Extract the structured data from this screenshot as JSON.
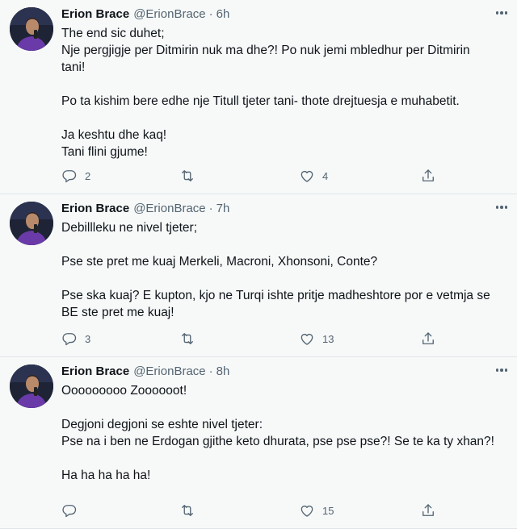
{
  "tweets": [
    {
      "author": {
        "name": "Erion Brace",
        "handle": "@ErionBrace"
      },
      "separator": "·",
      "time": "6h",
      "lines": [
        "The end sic duhet;",
        "Nje pergjigje per Ditmirin nuk ma dhe?! Po nuk jemi mbledhur per Ditmirin",
        "tani!",
        "",
        "Po ta kishim bere edhe nje Titull tjeter tani- thote drejtuesja e muhabetit.",
        "",
        "Ja keshtu dhe kaq!",
        "Tani flini gjume!"
      ],
      "stats": {
        "replies": "2",
        "retweets": "",
        "likes": "4"
      }
    },
    {
      "author": {
        "name": "Erion Brace",
        "handle": "@ErionBrace"
      },
      "separator": "·",
      "time": "7h",
      "lines": [
        "Debillleku ne nivel tjeter;",
        "",
        "Pse ste pret me kuaj Merkeli, Macroni, Xhonsoni, Conte?",
        "",
        "Pse ska kuaj? E kupton, kjo ne Turqi ishte pritje madheshtore por e vetmja se",
        "BE ste pret me kuaj!"
      ],
      "stats": {
        "replies": "3",
        "retweets": "",
        "likes": "13"
      }
    },
    {
      "author": {
        "name": "Erion Brace",
        "handle": "@ErionBrace"
      },
      "separator": "·",
      "time": "8h",
      "lines": [
        "Ooooooooo Zoooooot!",
        "",
        "Degjoni degjoni se eshte nivel tjeter:",
        "Pse na i ben ne Erdogan gjithe keto dhurata, pse pse pse?! Se te ka ty xhan?!",
        "",
        "Ha ha ha ha ha!"
      ],
      "stats": {
        "replies": "",
        "retweets": "",
        "likes": "15"
      }
    }
  ],
  "icons": {
    "reply": "reply-icon",
    "retweet": "retweet-icon",
    "like": "heart-icon",
    "share": "share-icon",
    "more": "more-icon"
  },
  "colors": {
    "background": "#f7f9f9",
    "secondary_text": "#536471",
    "divider": "#dfe4e7"
  }
}
